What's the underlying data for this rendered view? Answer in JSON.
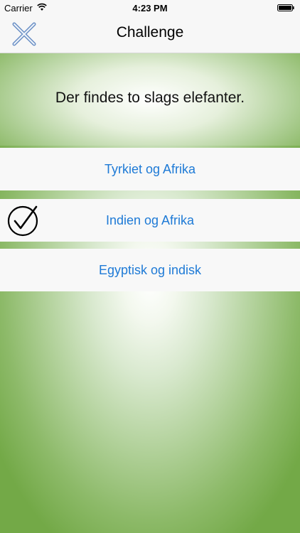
{
  "status_bar": {
    "carrier": "Carrier",
    "time": "4:23 PM",
    "wifi_icon": "wifi-icon",
    "battery_icon": "battery-icon"
  },
  "nav": {
    "title": "Challenge",
    "close_icon": "close-icon"
  },
  "question": {
    "text": "Der findes to slags elefanter."
  },
  "answers": [
    {
      "label": "Tyrkiet og Afrika",
      "selected": false
    },
    {
      "label": "Indien og Afrika",
      "selected": true
    },
    {
      "label": "Egyptisk og indisk",
      "selected": false
    }
  ],
  "colors": {
    "accent_blue": "#1e7ad6",
    "background_green": "#73a947",
    "close_icon_blue": "#6a8fc4"
  }
}
